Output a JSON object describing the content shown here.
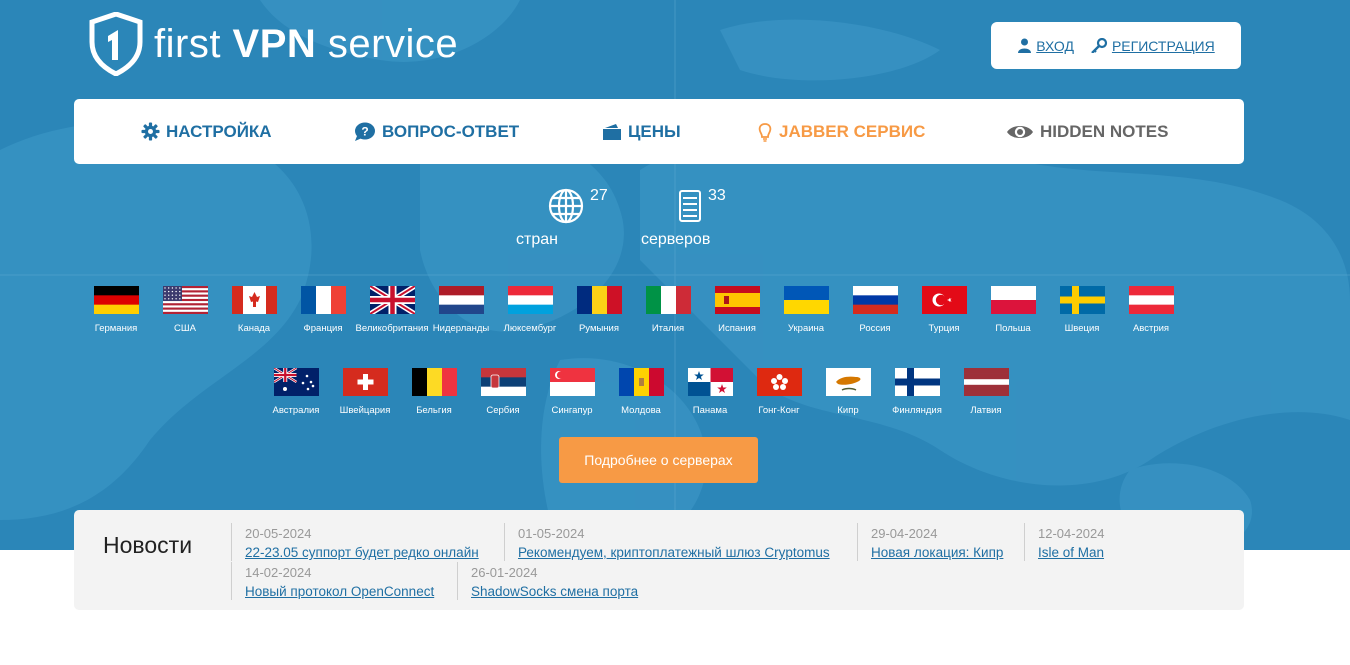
{
  "brand": {
    "part1": "first ",
    "part2": "VPN",
    "part3": " service"
  },
  "auth": {
    "login": "ВХОД",
    "register": "РЕГИСТРАЦИЯ"
  },
  "nav": [
    {
      "label": "НАСТРОЙКА",
      "icon": "gear-icon",
      "color": "#1f6fa3"
    },
    {
      "label": "ВОПРОС-ОТВЕТ",
      "icon": "question-icon",
      "color": "#1f6fa3"
    },
    {
      "label": "ЦЕНЫ",
      "icon": "wallet-icon",
      "color": "#1f6fa3"
    },
    {
      "label": "JABBER СЕРВИС",
      "icon": "lightbulb-icon",
      "color": "#f79a45"
    },
    {
      "label": "HIDDEN NOTES",
      "icon": "eye-icon",
      "color": "#666666"
    }
  ],
  "stats": {
    "countries_num": "27",
    "countries_label": "стран",
    "servers_num": "33",
    "servers_label": "серверов"
  },
  "flags_row1": [
    "Германия",
    "США",
    "Канада",
    "Франция",
    "Великобритания",
    "Нидерланды",
    "Люксембург",
    "Румыния",
    "Италия",
    "Испания",
    "Украина",
    "Россия",
    "Турция",
    "Польша",
    "Швеция",
    "Австрия"
  ],
  "flags_row2": [
    "Австралия",
    "Швейцария",
    "Бельгия",
    "Сербия",
    "Сингапур",
    "Молдова",
    "Панама",
    "Гонг-Конг",
    "Кипр",
    "Финляндия",
    "Латвия"
  ],
  "cta": "Подробнее о серверах",
  "news": {
    "title": "Новости",
    "items": [
      {
        "date": "20-05-2024",
        "text": "22-23.05 суппорт будет редко онлайн"
      },
      {
        "date": "01-05-2024",
        "text": "Рекомендуем, криптоплатежный шлюз Cryptomus"
      },
      {
        "date": "29-04-2024",
        "text": "Новая локация: Кипр"
      },
      {
        "date": "12-04-2024",
        "text": "Isle of Man"
      },
      {
        "date": "14-02-2024",
        "text": "Новый протокол OpenConnect"
      },
      {
        "date": "26-01-2024",
        "text": "ShadowSocks смена порта"
      }
    ]
  },
  "colors": {
    "hero": "#2b86b8",
    "accent": "#f79a45",
    "link": "#1f6fa3"
  }
}
